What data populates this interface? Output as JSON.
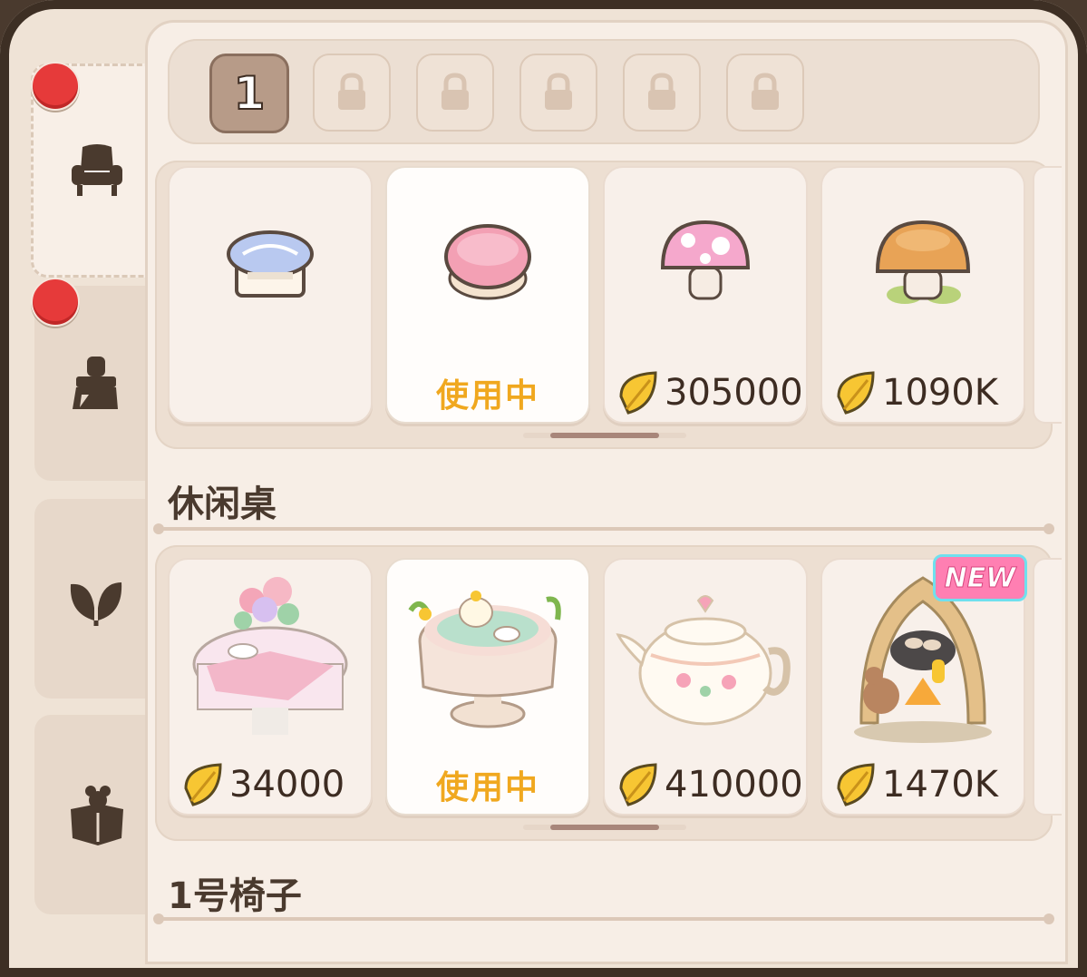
{
  "pages": {
    "current": "1",
    "locked_count": 5
  },
  "sidebar": {
    "tabs": [
      {
        "name": "furniture",
        "icon": "armchair-icon",
        "active": true,
        "badge": true
      },
      {
        "name": "decor",
        "icon": "paint-brush-icon",
        "active": false,
        "badge": true
      },
      {
        "name": "plants",
        "icon": "leaf-icon",
        "active": false,
        "badge": false
      },
      {
        "name": "storage",
        "icon": "box-icon",
        "active": false,
        "badge": false
      }
    ]
  },
  "row1": {
    "items": [
      {
        "icon": "blue-stool",
        "status": "",
        "price": ""
      },
      {
        "icon": "pink-round-stool",
        "status": "使用中",
        "price": ""
      },
      {
        "icon": "pink-mushroom-stool",
        "status": "",
        "price": "305000"
      },
      {
        "icon": "brown-mushroom-stool",
        "status": "",
        "price": "1090K"
      }
    ]
  },
  "section_leisure": {
    "title": "休闲桌"
  },
  "row2": {
    "items": [
      {
        "icon": "flower-table",
        "status": "",
        "price": "34000",
        "new": false
      },
      {
        "icon": "tea-table",
        "status": "使用中",
        "price": "",
        "new": false
      },
      {
        "icon": "teapot-table",
        "status": "",
        "price": "410000",
        "new": false
      },
      {
        "icon": "campfire-squirrel-table",
        "status": "",
        "price": "1470K",
        "new": true,
        "badge": "NEW"
      }
    ]
  },
  "section_chair": {
    "title": "1号椅子"
  },
  "colors": {
    "accent_status": "#f0a81f",
    "badge_red": "#e63a3a",
    "new_badge": "#ff7fb2"
  }
}
